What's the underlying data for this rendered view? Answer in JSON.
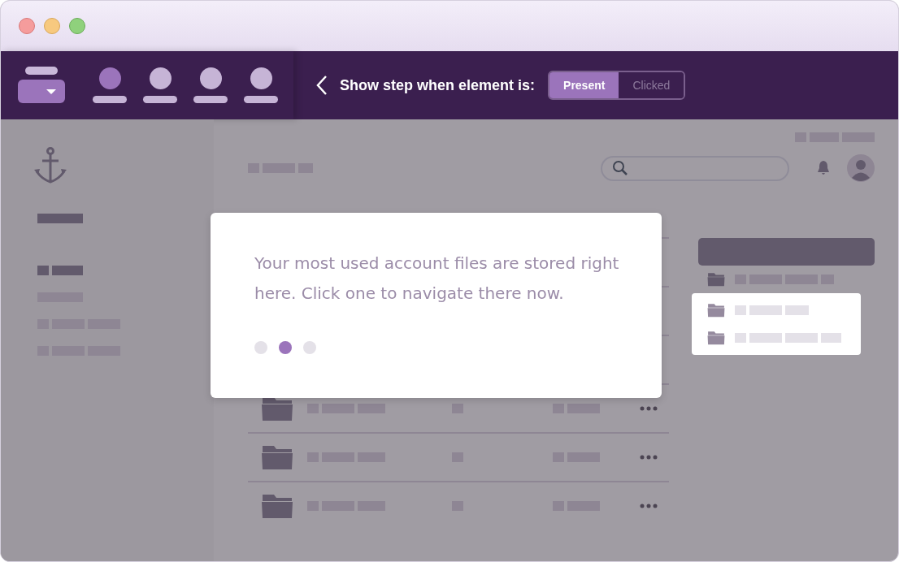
{
  "toolbar": {
    "steps": [
      {
        "selected": true
      },
      {
        "selected": false
      },
      {
        "selected": false
      },
      {
        "selected": false
      }
    ]
  },
  "step_trigger": {
    "label": "Show step when element is:",
    "options": [
      {
        "label": "Present",
        "selected": true
      },
      {
        "label": "Clicked",
        "selected": false
      }
    ]
  },
  "tooltip": {
    "text": "Your most used account files are stored right here. Click one to navigate there now.",
    "dots": [
      {
        "selected": false
      },
      {
        "selected": true
      },
      {
        "selected": false
      }
    ]
  }
}
